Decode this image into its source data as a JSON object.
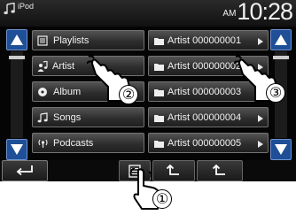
{
  "status_bar": {
    "source": "iPod",
    "ampm": "AM",
    "time": "10:28"
  },
  "categories": [
    {
      "label": "Playlists",
      "icon": "playlist-icon"
    },
    {
      "label": "Artist",
      "icon": "artist-icon"
    },
    {
      "label": "Album",
      "icon": "album-icon"
    },
    {
      "label": "Songs",
      "icon": "songs-icon"
    },
    {
      "label": "Podcasts",
      "icon": "podcasts-icon"
    }
  ],
  "artists": [
    {
      "label": "Artist 000000001"
    },
    {
      "label": "Artist 000000002"
    },
    {
      "label": "Artist 000000003"
    },
    {
      "label": "Artist 000000004"
    },
    {
      "label": "Artist 000000005"
    }
  ],
  "bottom_bar": {
    "back_icon": "return-icon",
    "list_icon": "list-icon",
    "up_icon": "up-level-icon",
    "top_icon": "top-level-icon"
  },
  "callouts": [
    "①",
    "②",
    "③"
  ],
  "colors": {
    "accent_blue": "#1f4f96",
    "screen_bg": "#050505"
  }
}
